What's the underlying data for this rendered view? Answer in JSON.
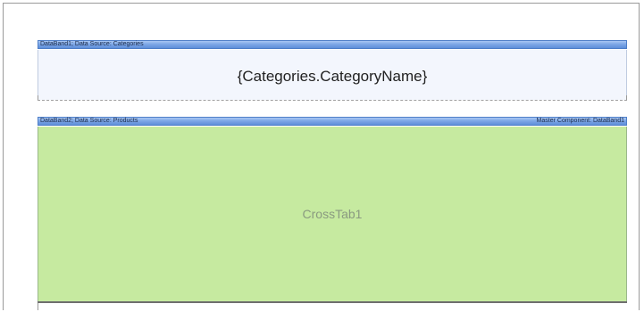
{
  "band1": {
    "header_label": "DataBand1; Data Source: Categories",
    "field_expression": "{Categories.CategoryName}"
  },
  "band2": {
    "header_label": "DataBand2; Data Source: Products",
    "master_label": "Master Component: DataBand1",
    "component_label": "CrossTab1"
  },
  "colors": {
    "band_header": "#7da7e6",
    "band1_background": "#f3f6fd",
    "crosstab_background": "#c6eaa0"
  }
}
